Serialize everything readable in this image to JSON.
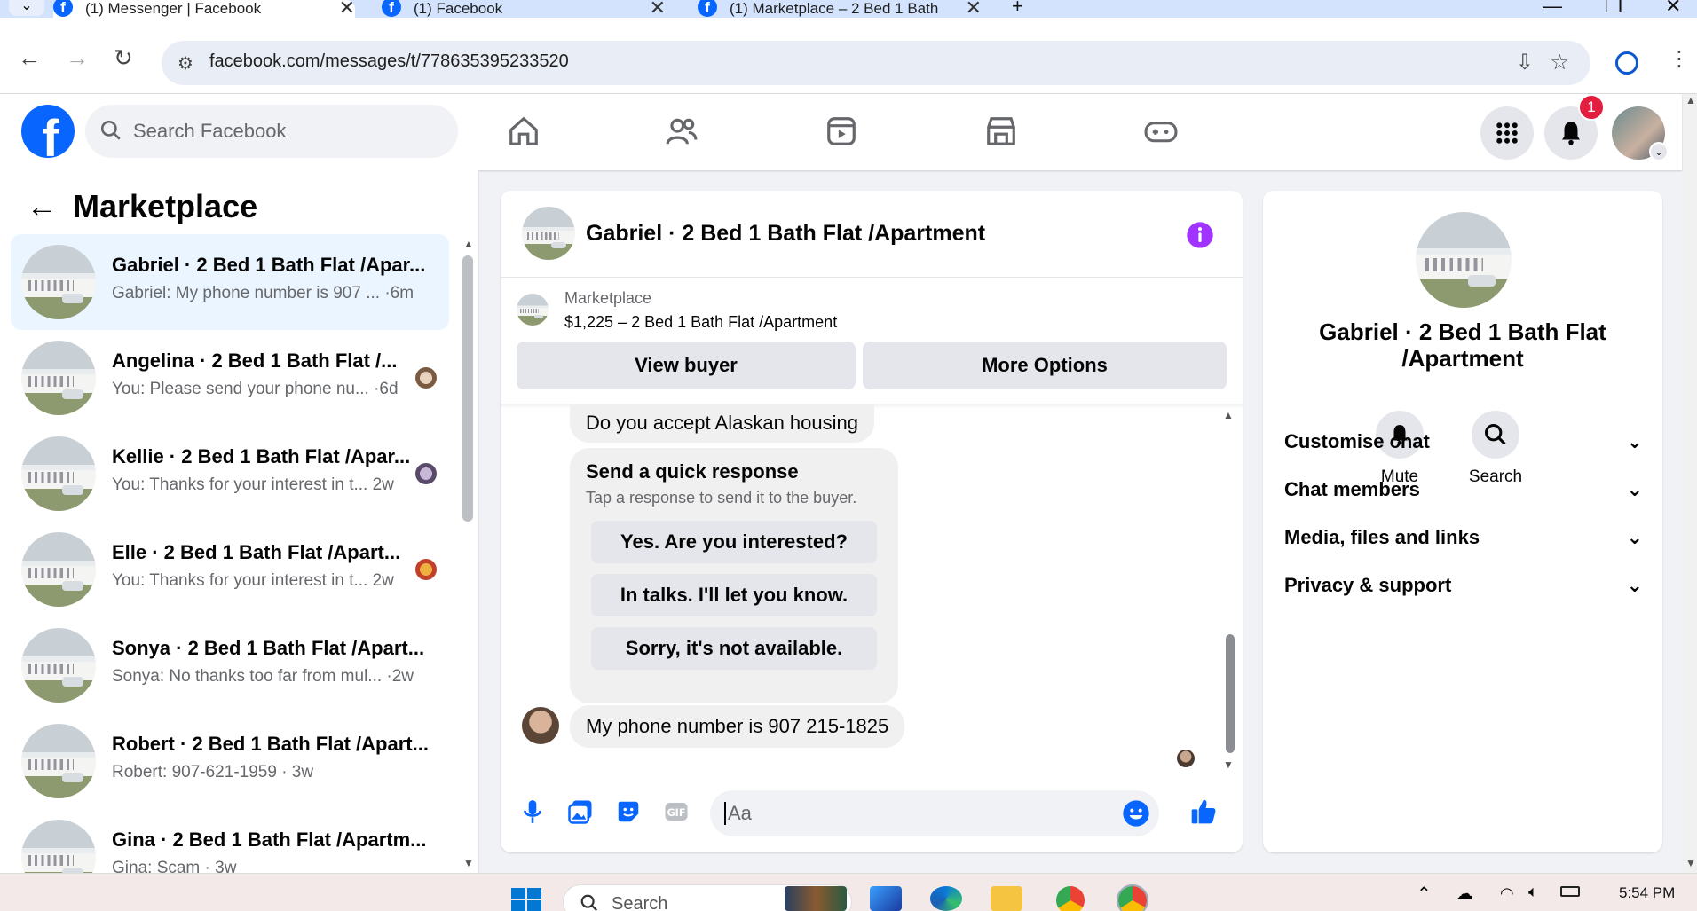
{
  "browser": {
    "tabs": [
      {
        "title": "(1) Messenger | Facebook"
      },
      {
        "title": "(1) Facebook"
      },
      {
        "title": "(1) Marketplace – 2 Bed 1 Bath"
      }
    ],
    "url": "facebook.com/messages/t/778635395233520"
  },
  "fb": {
    "search_placeholder": "Search Facebook",
    "notification_count": "1"
  },
  "left": {
    "title": "Marketplace",
    "conversations": [
      {
        "name": "Gabriel · 2 Bed 1 Bath Flat /Apar...",
        "preview": "Gabriel: My phone number is 907 ... ·6m"
      },
      {
        "name": "Angelina · 2 Bed 1 Bath Flat /...",
        "preview": "You: Please send your phone nu... ·6d"
      },
      {
        "name": "Kellie · 2 Bed 1 Bath Flat /Apar...",
        "preview": "You: Thanks for your interest in t... 2w"
      },
      {
        "name": "Elle · 2 Bed 1 Bath Flat /Apart...",
        "preview": "You: Thanks for your interest in t... 2w"
      },
      {
        "name": "Sonya · 2 Bed 1 Bath Flat /Apart...",
        "preview": "Sonya: No thanks too far from mul... ·2w"
      },
      {
        "name": "Robert · 2 Bed 1 Bath Flat /Apart...",
        "preview": "Robert: 907-621-1959 · 3w"
      },
      {
        "name": "Gina · 2 Bed 1 Bath Flat /Apartm...",
        "preview": "Gina: Scam · 3w"
      }
    ]
  },
  "chat": {
    "title": "Gabriel · 2 Bed 1 Bath Flat /Apartment",
    "listing_label": "Marketplace",
    "listing_desc": "$1,225 – 2 Bed 1 Bath Flat /Apartment",
    "view_buyer": "View buyer",
    "more_options": "More Options",
    "messages": {
      "m1": "Do you accept Alaskan housing",
      "quick_title": "Send a quick response",
      "quick_sub": "Tap a response to send it to the buyer.",
      "quick_1": "Yes. Are you interested?",
      "quick_2": "In talks. I'll let you know.",
      "quick_3": "Sorry, it's not available.",
      "m2": "My phone number is 907 215-1825"
    },
    "input_placeholder": "Aa"
  },
  "right": {
    "name": "Gabriel · 2 Bed 1 Bath Flat /Apartment",
    "mute": "Mute",
    "search": "Search",
    "rows": [
      "Customise chat",
      "Chat members",
      "Media, files and links",
      "Privacy & support"
    ]
  },
  "taskbar": {
    "search_placeholder": "Search",
    "time": "5:54 PM"
  },
  "colors": {
    "fb_blue": "#0866ff",
    "accent_purple": "#a033ff",
    "badge_red": "#e41e3f"
  }
}
